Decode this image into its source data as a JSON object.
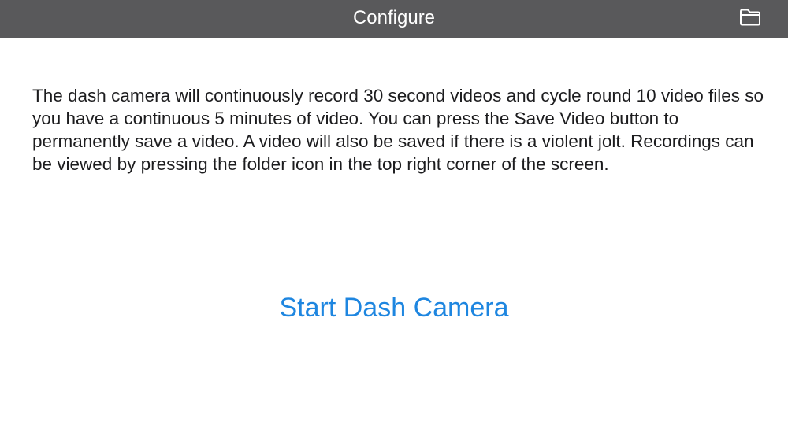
{
  "nav": {
    "title": "Configure",
    "folder_icon": "folder-icon"
  },
  "main": {
    "description": "The dash camera will continuously record 30 second videos and cycle round 10 video files so you have a continuous 5 minutes of video. You can press the Save Video button to permanently save a video. A video will also be saved if there is a violent jolt. Recordings can be viewed by pressing the folder icon in the top right corner of the screen.",
    "start_button_label": "Start Dash Camera"
  },
  "colors": {
    "nav_background": "#59595b",
    "accent": "#1e86e0",
    "text": "#1c1c1e"
  }
}
